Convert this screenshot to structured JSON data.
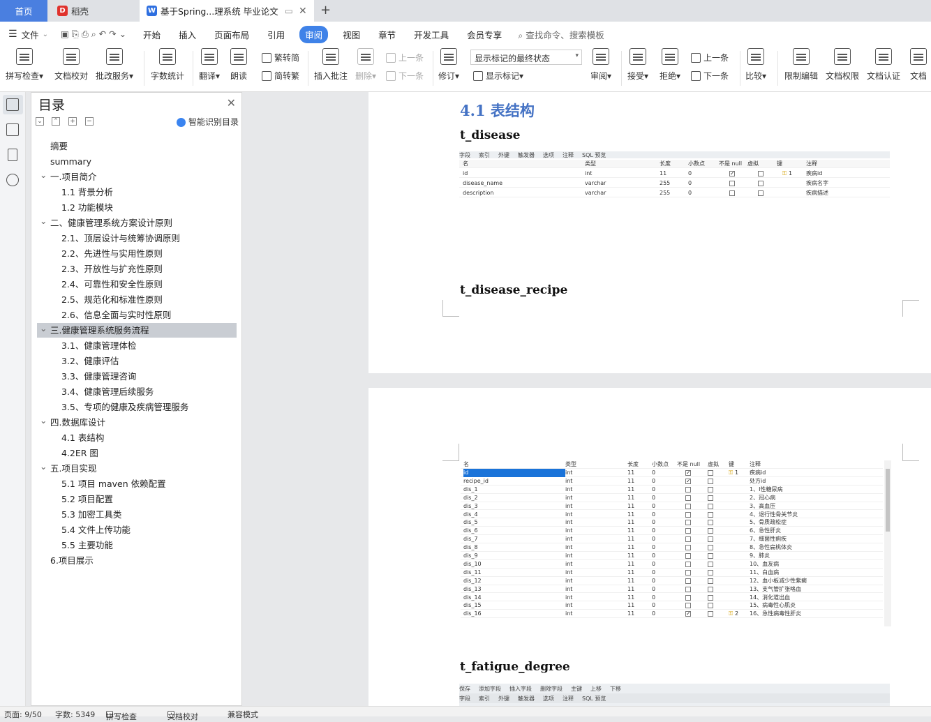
{
  "tabs": {
    "home": "首页",
    "daoke": "稻壳",
    "doc": "基于Spring...理系统 毕业论文"
  },
  "menu": [
    "文件",
    "开始",
    "插入",
    "页面布局",
    "引用",
    "审阅",
    "视图",
    "章节",
    "开发工具",
    "会员专享"
  ],
  "search_placeholder": "查找命令、搜索模板",
  "ribbon": {
    "spell": "拼写检查",
    "proof": "文档校对",
    "batch": "批改服务",
    "wordcount": "字数统计",
    "translate": "翻译",
    "read": "朗读",
    "trad": "繁转简",
    "simp": "简转繁",
    "insert_comment": "插入批注",
    "delete": "删除",
    "prev": "上一条",
    "next": "下一条",
    "revise": "修订",
    "mark_state": "显示标记的最终状态",
    "show_marks": "显示标记",
    "review": "审阅",
    "accept": "接受",
    "reject": "拒绝",
    "prev2": "上一条",
    "next2": "下一条",
    "compare": "比较",
    "restrict": "限制编辑",
    "permission": "文档权限",
    "certify": "文档认证",
    "more": "文档"
  },
  "toc": {
    "title": "目录",
    "smart": "智能识别目录",
    "items": [
      "摘要",
      "summary",
      "一.项目简介",
      "1.1 背景分析",
      "1.2 功能模块",
      "二、健康管理系统方案设计原则",
      "2.1、顶层设计与统筹协调原则",
      "2.2、先进性与实用性原则",
      "2.3、开放性与扩充性原则",
      "2.4、可靠性和安全性原则",
      "2.5、规范化和标准性原则",
      "2.6、信息全面与实时性原则",
      "三.健康管理系统服务流程",
      "3.1、健康管理体检",
      "3.2、健康评估",
      "3.3、健康管理咨询",
      "3.4、健康管理后续服务",
      "3.5、专项的健康及疾病管理服务",
      "四.数据库设计",
      "4.1 表结构",
      "4.2ER 图",
      "五.项目实现",
      "5.1 项目 maven 依赖配置",
      "5.2 项目配置",
      "5.3 加密工具类",
      "5.4 文件上传功能",
      "5.5 主要功能",
      "6.项目展示"
    ]
  },
  "doc": {
    "heading": "4.1 表结构",
    "t1": "t_disease",
    "t2": "t_disease_recipe",
    "t3": "t_fatigue_degree",
    "tabs_bar": [
      "字段",
      "索引",
      "外键",
      "触发器",
      "选项",
      "注释",
      "SQL 预览"
    ],
    "cols": [
      "名",
      "类型",
      "长度",
      "小数点",
      "不是 null",
      "虚拟",
      "键",
      "注释"
    ],
    "disease_rows": [
      {
        "name": "id",
        "type": "int",
        "len": "11",
        "dec": "0",
        "nn": true,
        "key": "1",
        "note": "疾病id"
      },
      {
        "name": "disease_name",
        "type": "varchar",
        "len": "255",
        "dec": "0",
        "nn": false,
        "key": "",
        "note": "疾病名字"
      },
      {
        "name": "description",
        "type": "varchar",
        "len": "255",
        "dec": "0",
        "nn": false,
        "key": "",
        "note": "疾病描述"
      }
    ],
    "recipe_rows": [
      {
        "name": "id",
        "note": "疾病id",
        "nn": true,
        "key": "1"
      },
      {
        "name": "recipe_id",
        "note": "处方id",
        "nn": true,
        "key": ""
      },
      {
        "name": "dis_1",
        "note": "1、I性糖尿病",
        "nn": false,
        "key": ""
      },
      {
        "name": "dis_2",
        "note": "2、冠心病",
        "nn": false,
        "key": ""
      },
      {
        "name": "dis_3",
        "note": "3、高血压",
        "nn": false,
        "key": ""
      },
      {
        "name": "dis_4",
        "note": "4、退行性骨关节炎",
        "nn": false,
        "key": ""
      },
      {
        "name": "dis_5",
        "note": "5、骨质疏松症",
        "nn": false,
        "key": ""
      },
      {
        "name": "dis_6",
        "note": "6、急性肝炎",
        "nn": false,
        "key": ""
      },
      {
        "name": "dis_7",
        "note": "7、细菌性痢疾",
        "nn": false,
        "key": ""
      },
      {
        "name": "dis_8",
        "note": "8、急性扁桃体炎",
        "nn": false,
        "key": ""
      },
      {
        "name": "dis_9",
        "note": "9、肺炎",
        "nn": false,
        "key": ""
      },
      {
        "name": "dis_10",
        "note": "10、血友病",
        "nn": false,
        "key": ""
      },
      {
        "name": "dis_11",
        "note": "11、白血病",
        "nn": false,
        "key": ""
      },
      {
        "name": "dis_12",
        "note": "12、血小板减少性紫癜",
        "nn": false,
        "key": ""
      },
      {
        "name": "dis_13",
        "note": "13、支气管扩张咯血",
        "nn": false,
        "key": ""
      },
      {
        "name": "dis_14",
        "note": "14、消化道出血",
        "nn": false,
        "key": ""
      },
      {
        "name": "dis_15",
        "note": "15、病毒性心肌炎",
        "nn": false,
        "key": ""
      },
      {
        "name": "dis_16",
        "note": "16、急性病毒性肝炎",
        "nn": true,
        "key": "2"
      }
    ],
    "toolbar3": [
      "保存",
      "添加字段",
      "插入字段",
      "删除字段",
      "主键",
      "上移",
      "下移"
    ]
  },
  "status": {
    "page": "页面: 9/50",
    "words": "字数: 5349",
    "spell": "拼写检查",
    "proof": "文档校对",
    "compat": "兼容模式"
  }
}
